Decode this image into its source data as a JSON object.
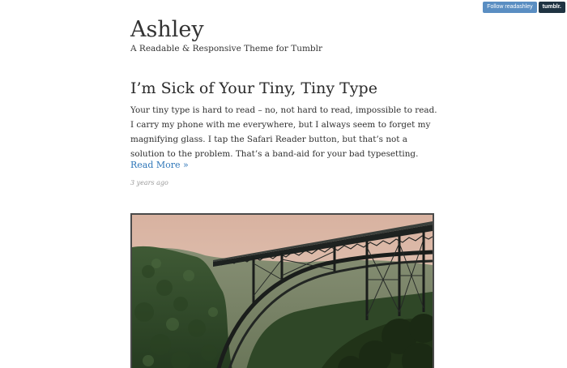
{
  "tumblr_controls": {
    "follow_label": "Follow readashley",
    "tumblr_label": "tumblr."
  },
  "site": {
    "title": "Ashley",
    "description": "A Readable & Responsive Theme for Tumblr"
  },
  "post": {
    "title": "I’m Sick of Your Tiny, Tiny Type",
    "body": "Your tiny type is hard to read – no, not hard to read, impossible to read. I carry my phone with me everywhere, but I always seem to forget my magnifying glass. I tap the Safari Reader button, but that’s not a solution to the problem. That’s a band-aid for your bad typesetting.",
    "read_more": "Read More »",
    "date": "3 years ago"
  },
  "colors": {
    "link": "#2e76b8",
    "follow_button": "#5a8ec2",
    "tumblr_button": "#1f3342",
    "meta_text": "#9a9a9a"
  }
}
